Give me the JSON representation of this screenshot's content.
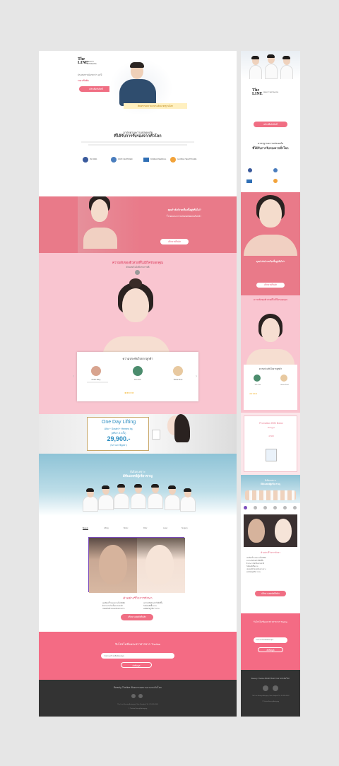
{
  "brand": {
    "logo_line1": "The",
    "logo_line2": "LINE",
    "logo_sub": "BEAUTY ANTIAGING"
  },
  "hero": {
    "text1": "ประสบการณ์มากกว่า 10 ปี",
    "price_label": "ราคาเริ่มต้น",
    "cta": "คลิกเพื่อรับสิทธิ์",
    "banner": "ศัลยกรรมความงามระดับมาตรฐานโลก"
  },
  "standard": {
    "title_line1": "มาตรฐานความปลอดภัย",
    "title_line2": "ที่ได้รับการรับรองจากทั่วโลก",
    "badges": [
      "ISO 9001",
      "KAHF CERTIFIED",
      "KOREAN MEDICAL",
      "GLOBAL HEALTHCARE"
    ]
  },
  "concern": {
    "text1": "คุณกำลังกังวลเรื่องนี้อยู่หรือไม่?",
    "text2": "ริ้วรอยและความหย่อนคล้อยบนใบหน้า",
    "cta": "ปรึกษาฟรีคลิก"
  },
  "secret": {
    "title": "ความลับของผิวสวยที่ไม่มีใครบอกคุณ",
    "subtitle": "ด้วยเทคโนโลยีจากเกาหลี"
  },
  "reviews": {
    "title": "ความประทับใจจากลูกค้า",
    "people": [
      {
        "name": "Dolan Ming",
        "stars": "★★★★★"
      },
      {
        "name": "Kim Tom",
        "stars": "★★★★★"
      },
      {
        "name": "Hanai Prod",
        "stars": "★★★★★"
      }
    ],
    "prev": "‹",
    "next": "›"
  },
  "promo": {
    "title": "One Day Lifting",
    "line1": "Ulfu + Sostel + Hemes Inj.",
    "line2": "(ฟรีค่า 3 ครั้ง)",
    "price": "29,900.-",
    "suffix": "(ไม่รวมภาษีมูลค่า)"
  },
  "doctors": {
    "title_line1": "ดีเลือกเพราะ",
    "title_line2": "มีทีมแพทย์ผู้เชี่ยวชาญ"
  },
  "tabs": [
    "Beauty",
    "Lifting",
    "Botox",
    "Filler",
    "Laser",
    "Surgery"
  ],
  "results": {
    "title": "ตัวอย่างรีวิวการรักษา",
    "items": [
      "ลดเลือนริ้วรอยอย่างเห็นได้ชัด",
      "ยกกระชับผิวหน้าให้ตึงขึ้น",
      "ผิวกระจ่างใสเป็นธรรมชาติ",
      "ไม่ต้องพักฟื้นนาน",
      "ปลอดภัยด้วยแพทย์เฉพาะทาง",
      "ผลลัพธ์อยู่ได้ยาวนาน"
    ],
    "cta": "ปรึกษาแพทย์ฟรีคลิก"
  },
  "signup": {
    "title": "รับโปรโมชั่นและข่าวสารจาก Theline",
    "placeholder": "กรอกเบอร์โทรศัพท์ของคุณ",
    "submit": "ส่งข้อมูล"
  },
  "footer": {
    "title": "Beauty Theline ศัลยกรรมความงามระดับโลก",
    "address": "The Line Beauty Antiaging Clinic Bangkok Tel. 02-000-0000",
    "copyright": "© Theline Beauty Antiaging"
  },
  "mobile": {
    "promo_title": "Promotion Ellfé Botox",
    "promo_sub": "Dongyo",
    "promo_price": "4,500",
    "results_title": "ตัวอย่างรีวิวการรักษา"
  },
  "colors": {
    "pink": "#f06e83",
    "dark_pink": "#e25c77",
    "light_pink": "#f8c8d2",
    "dark": "#333333",
    "teal": "#8ec3d6"
  }
}
